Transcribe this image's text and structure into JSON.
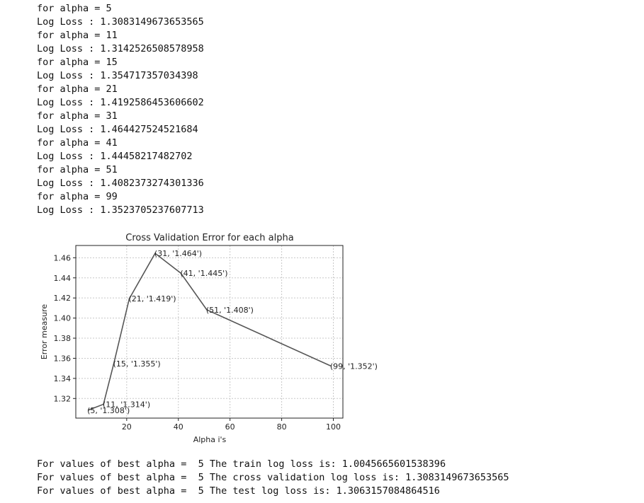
{
  "log_lines": [
    "for alpha = 5",
    "Log Loss : 1.3083149673653565",
    "for alpha = 11",
    "Log Loss : 1.3142526508578958",
    "for alpha = 15",
    "Log Loss : 1.354717357034398",
    "for alpha = 21",
    "Log Loss : 1.4192586453606602",
    "for alpha = 31",
    "Log Loss : 1.464427524521684",
    "for alpha = 41",
    "Log Loss : 1.44458217482702",
    "for alpha = 51",
    "Log Loss : 1.4082373274301336",
    "for alpha = 99",
    "Log Loss : 1.3523705237607713"
  ],
  "chart_data": {
    "type": "line",
    "title": "Cross Validation Error for each alpha",
    "xlabel": "Alpha i's",
    "ylabel": "Error measure",
    "x": [
      5,
      11,
      15,
      21,
      31,
      41,
      51,
      99
    ],
    "y": [
      1.3083149673653565,
      1.3142526508578958,
      1.354717357034398,
      1.4192586453606602,
      1.464427524521684,
      1.44458217482702,
      1.4082373274301336,
      1.3523705237607713
    ],
    "annotations": [
      "(5, '1.308')",
      "(11, '1.314')",
      "(15, '1.355')",
      "(21, '1.419')",
      "(31, '1.464')",
      "(41, '1.445')",
      "(51, '1.408')",
      "(99, '1.352')"
    ],
    "xticks": [
      20,
      40,
      60,
      80,
      100
    ],
    "yticks": [
      1.32,
      1.34,
      1.36,
      1.38,
      1.4,
      1.42,
      1.44,
      1.46
    ],
    "ytick_labels": [
      "1.32",
      "1.34",
      "1.36",
      "1.38",
      "1.40",
      "1.42",
      "1.44",
      "1.46"
    ],
    "xlim": [
      0.3,
      103.7
    ],
    "ylim": [
      1.3005,
      1.4722
    ],
    "grid": true,
    "line_color": "#555555"
  },
  "footer_lines": [
    "For values of best alpha =  5 The train log loss is: 1.0045665601538396",
    "For values of best alpha =  5 The cross validation log loss is: 1.3083149673653565",
    "For values of best alpha =  5 The test log loss is: 1.3063157084864516"
  ]
}
